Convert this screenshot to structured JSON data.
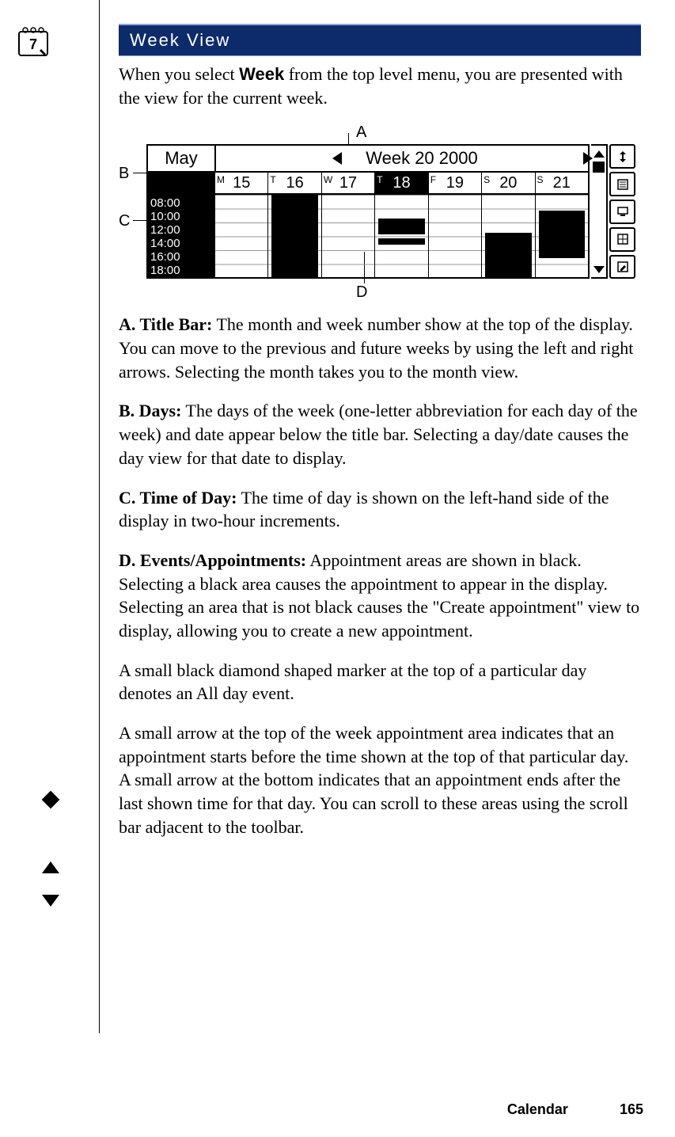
{
  "header": "Week View",
  "intro_before": "When you select ",
  "intro_bold": "Week",
  "intro_after": " from the top level menu, you are presented with the view for the current week.",
  "callouts": {
    "A": "A",
    "B": "B",
    "C": "C",
    "D": "D"
  },
  "figure": {
    "month": "May",
    "week_title": "Week 20 2000",
    "days": [
      {
        "letter": "M",
        "num": "15"
      },
      {
        "letter": "T",
        "num": "16"
      },
      {
        "letter": "W",
        "num": "17"
      },
      {
        "letter": "T",
        "num": "18",
        "selected": true,
        "hasDiamond": true
      },
      {
        "letter": "F",
        "num": "19"
      },
      {
        "letter": "S",
        "num": "20"
      },
      {
        "letter": "S",
        "num": "21"
      }
    ],
    "times": [
      "08:00",
      "10:00",
      "12:00",
      "14:00",
      "16:00",
      "18:00"
    ]
  },
  "paragraphs": {
    "A_title": "A. Title Bar:",
    "A_body": " The month and week number show at the top of the display. You can move to the previous and future weeks by using the left and right arrows. Selecting the month takes you to the month view.",
    "B_title": "B. Days:",
    "B_body": " The days of the week (one-letter abbreviation for each day of the week) and date appear below the title bar. Selecting a day/date causes the day view for that date to display.",
    "C_title": "C. Time of Day:",
    "C_body": " The time of day is shown on the left-hand side of the display in two-hour increments.",
    "D_title": "D. Events/Appointments:",
    "D_body": " Appointment areas are shown in black. Selecting a black area causes the appointment to appear in the display. Selecting an area that is not black causes the \"Create appointment\" view to display, allowing you to create a new appointment.",
    "diamond": "A small black diamond shaped marker at the top of a particular day denotes an All day event.",
    "arrows": "A small arrow at the top of the week appointment area indicates that an appointment starts before the time shown at the top of that particular day. A small arrow at the bottom indicates that an appointment ends after the last shown time for that day. You can scroll to these areas using the scroll bar adjacent to the toolbar."
  },
  "footer": {
    "section": "Calendar",
    "page": "165"
  }
}
